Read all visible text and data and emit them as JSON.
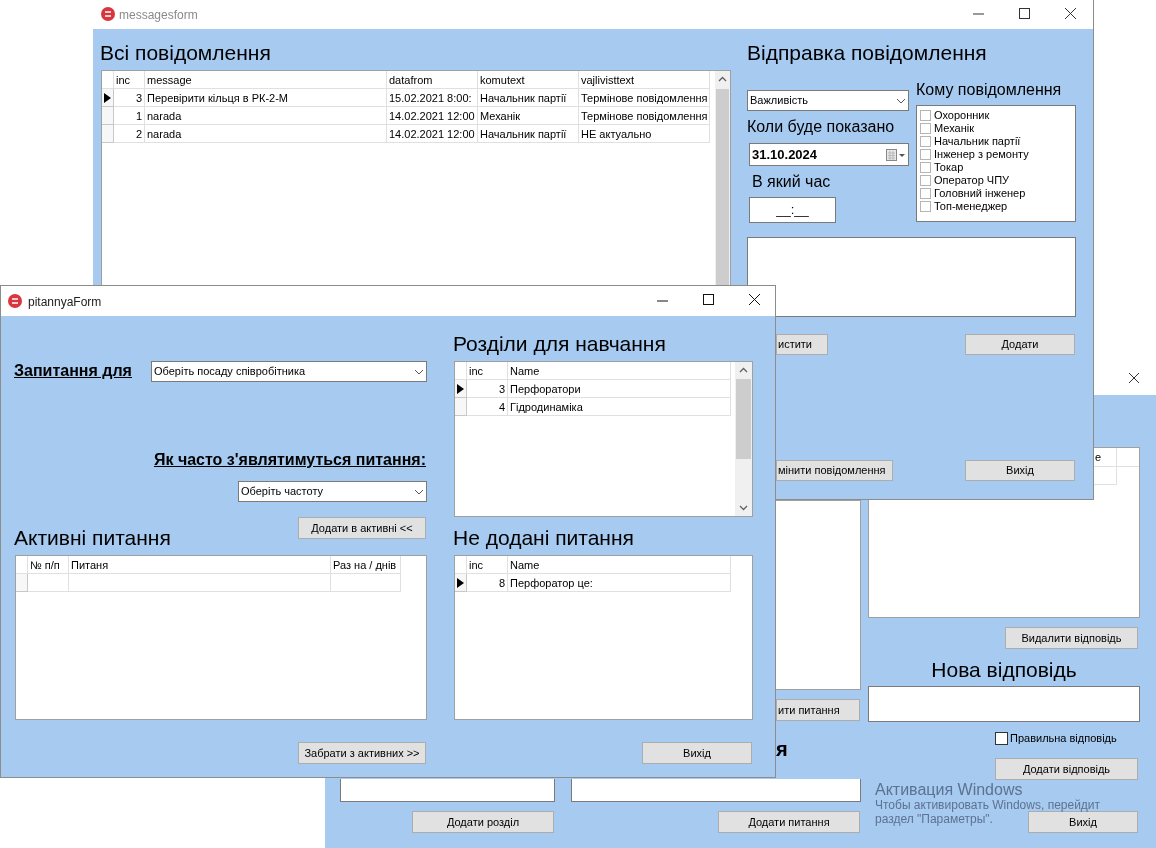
{
  "messages_form": {
    "title": "messagesform",
    "all_messages": {
      "heading": "Всі повідомлення",
      "grid": {
        "columns": [
          "inc",
          "message",
          "datafrom",
          "komutext",
          "vajlivisttext"
        ],
        "rows": [
          {
            "selected": true,
            "cells": [
              "3",
              "Перевірити кільця в РК-2-М",
              "15.02.2021 8:00:",
              "Начальник партії",
              "Термінове повідомлення"
            ]
          },
          {
            "selected": false,
            "cells": [
              "1",
              "narada",
              "14.02.2021 12:00",
              "Механік",
              "Термінове повідомлення"
            ]
          },
          {
            "selected": false,
            "cells": [
              "2",
              "narada",
              "14.02.2021 12:00",
              "Начальник партії",
              "НЕ актуально"
            ]
          }
        ]
      }
    },
    "send": {
      "heading": "Відправка повідомлення",
      "importance": {
        "value": "Важливість"
      },
      "recipients_label": "Кому повідомлення",
      "recipients": [
        {
          "label": "Охоронник",
          "checked": false
        },
        {
          "label": "Механік",
          "checked": false
        },
        {
          "label": "Начальник партії",
          "checked": false
        },
        {
          "label": "Інженер з ремонту",
          "checked": false
        },
        {
          "label": "Токар",
          "checked": false
        },
        {
          "label": "Оператор ЧПУ",
          "checked": false
        },
        {
          "label": "Головний інженер",
          "checked": false
        },
        {
          "label": "Топ-менеджер",
          "checked": false
        }
      ],
      "date_label": "Коли буде показано",
      "date_value": "31.10.2024",
      "time_label": "В який час",
      "time_value": "__:__",
      "clear_button": "истити",
      "add_button": "Додати",
      "change_button": "мінити повідомлення",
      "exit_button": "Вихід"
    }
  },
  "pitannya_form": {
    "title": "pitannyaForm",
    "question_for_label": "Запитання для",
    "position_combo": {
      "value": "Оберіть посаду співробітника"
    },
    "frequency_label": "Як часто з'являтимуться питання:",
    "frequency_combo": {
      "value": "Оберіть частоту"
    },
    "add_active_button": "Додати в активні <<",
    "active_heading": "Активні питання",
    "active_grid": {
      "columns": [
        "№ п/п",
        "Питаня",
        "Раз на / днів"
      ]
    },
    "remove_active_button": "Забрати з активних >>",
    "sections_heading": "Розділи для навчання",
    "sections_grid": {
      "columns": [
        "inc",
        "Name"
      ],
      "rows": [
        {
          "selected": true,
          "cells": [
            "3",
            "Перфоратори"
          ]
        },
        {
          "selected": false,
          "cells": [
            "4",
            "Гідродинаміка"
          ]
        }
      ]
    },
    "not_added_heading": "Не додані питання",
    "not_added_grid": {
      "columns": [
        "inc",
        "Name"
      ],
      "rows": [
        {
          "selected": true,
          "cells": [
            "8",
            "Перфоратор це:"
          ]
        }
      ]
    },
    "exit_button": "Вихід"
  },
  "answers_form": {
    "grid_header_fragment": "е",
    "delete_answer_button": "Видалити відповідь",
    "new_answer_heading": "Нова відповідь",
    "correct_answer": {
      "label": "Правильна відповідь",
      "checked": false
    },
    "add_answer_button": "Додати відповідь",
    "exit_button": "Вихід",
    "add_question_button_fragment": "ити питання",
    "heading_fragment": "я",
    "add_section_button": "Додати розділ",
    "add_question_button": "Додати питання"
  },
  "activation_notice": {
    "title": "Активация Windows",
    "lines": [
      "Чтобы активировать Windows, перейдит",
      "раздел \"Параметры\"."
    ]
  }
}
